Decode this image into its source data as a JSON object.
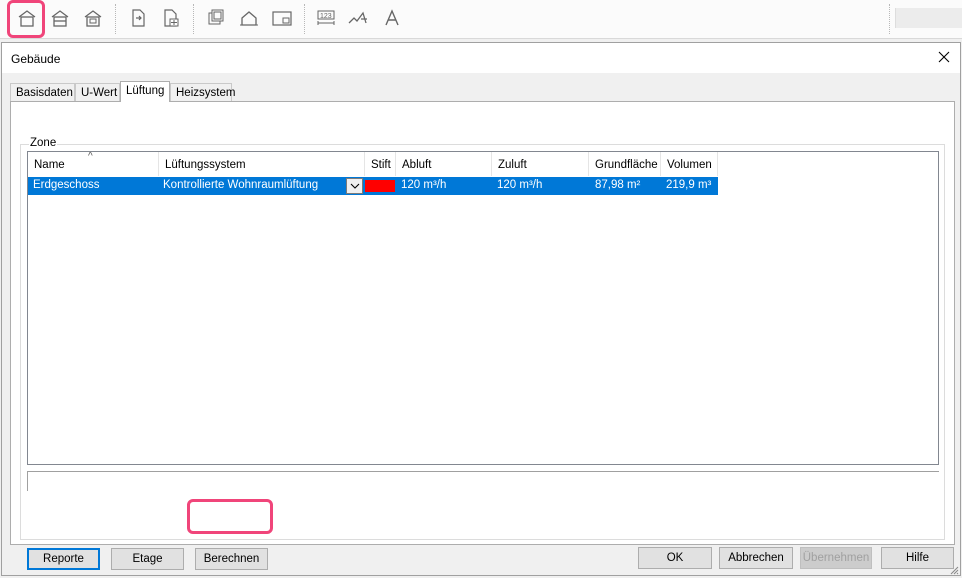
{
  "toolbar": {
    "icons": [
      "house-icon",
      "house-floor-icon",
      "house-rooms-icon",
      "export-doc-icon",
      "doc-settings-icon",
      "layers-icon",
      "house-outline-icon",
      "frame-icon",
      "dimension-icon",
      "line-style-icon",
      "text-icon"
    ]
  },
  "dialog": {
    "title": "Gebäude",
    "tabs": [
      "Basisdaten",
      "U-Wert",
      "Lüftung",
      "Heizsystem"
    ],
    "active_tab": "Lüftung",
    "group_label": "Zone",
    "columns": [
      "Name",
      "Lüftungssystem",
      "Stift",
      "Abluft",
      "Zuluft",
      "Grundfläche",
      "Volumen"
    ],
    "rows": [
      {
        "name": "Erdgeschoss",
        "system": "Kontrollierte Wohnraumlüftung",
        "stift_color": "#ff0000",
        "abluft": "120 m³/h",
        "zuluft": "120 m³/h",
        "grundflaeche": "87,98 m²",
        "volumen": "219,9 m³"
      }
    ],
    "panel_buttons": {
      "reporte": "Reporte",
      "etage": "Etage",
      "berechnen": "Berechnen"
    },
    "footer_buttons": {
      "ok": "OK",
      "abbrechen": "Abbrechen",
      "uebernehmen": "Übernehmen",
      "hilfe": "Hilfe"
    }
  },
  "colors": {
    "selection": "#0078d7",
    "highlight": "#f0457a",
    "stift": "#ff0000"
  }
}
